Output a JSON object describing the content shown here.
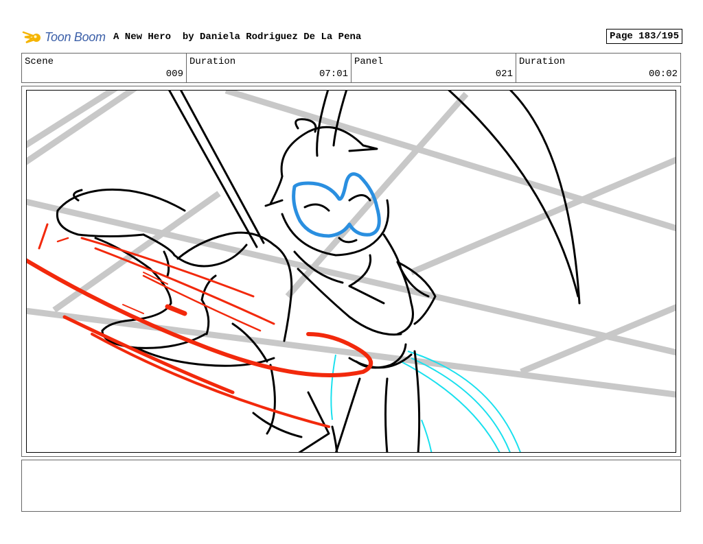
{
  "header": {
    "logo_text": "Toon Boom",
    "project_title": "A New Hero",
    "author": "by Daniela Rodriguez De La Pena",
    "page": "Page 183/195"
  },
  "info": {
    "scene_label": "Scene",
    "scene_value": "009",
    "scene_duration_label": "Duration",
    "scene_duration_value": "07:01",
    "panel_label": "Panel",
    "panel_value": "021",
    "panel_duration_label": "Duration",
    "panel_duration_value": "00:02"
  },
  "notes": {
    "text": ""
  },
  "colors": {
    "logo_blue": "#3b5fa8",
    "logo_yellow": "#f5b400",
    "sketch_red": "#f2290c",
    "sketch_blue": "#2a8fe0",
    "sketch_cyan": "#19e0ee",
    "girder_gray": "#c8c8c8"
  }
}
